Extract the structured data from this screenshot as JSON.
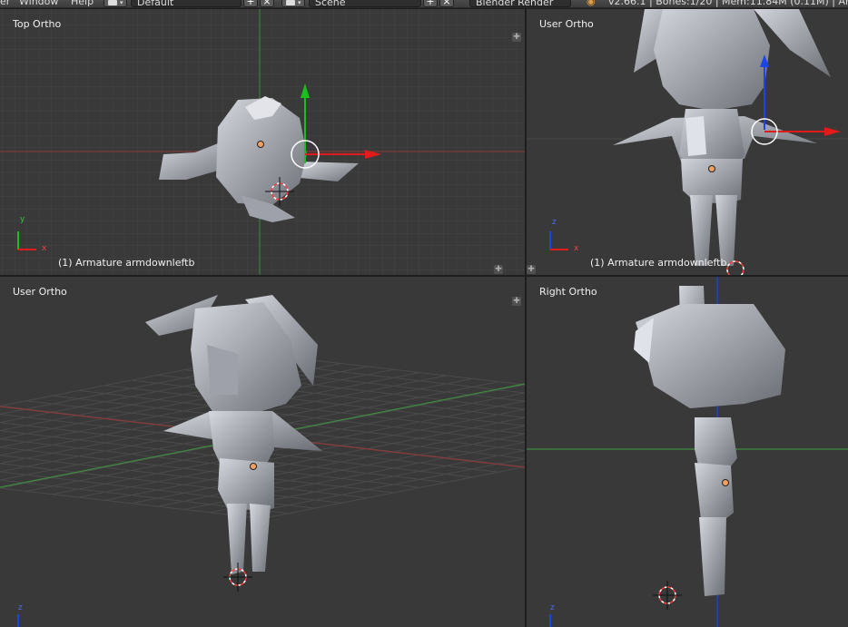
{
  "header": {
    "menu_partial": "er",
    "menu_window": "Window",
    "menu_help": "Help",
    "screen_layout": "Default",
    "scene": "Scene",
    "render_engine": "Blender Render",
    "stats": "v2.66.1 | Bones:1/20 | Mem:11.84M (0.11M) | Arma"
  },
  "viewports": {
    "top_left": {
      "label": "Top Ortho",
      "object": "(1) Armature armdownleftb"
    },
    "top_right": {
      "label": "User Ortho",
      "object": "(1) Armature armdownleftb"
    },
    "bottom_left": {
      "label": "User Ortho"
    },
    "bottom_right": {
      "label": "Right Ortho"
    }
  },
  "axes": {
    "x": "x",
    "y": "y",
    "z": "z"
  },
  "colors": {
    "viewport_bg": "#393939",
    "grid": "#444444",
    "axis_x": "#8a3a3a",
    "axis_y": "#3f8a3f",
    "manip_x": "#e11a1a",
    "manip_y": "#19c019",
    "manip_z": "#1a45e8",
    "model": "#b9bcc4",
    "origin": "#f0a060"
  }
}
